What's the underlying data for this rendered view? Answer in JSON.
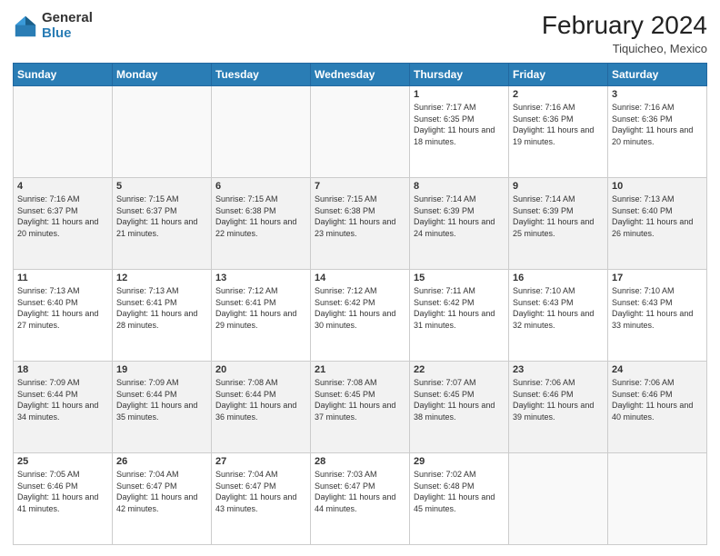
{
  "header": {
    "logo_line1": "General",
    "logo_line2": "Blue",
    "month_year": "February 2024",
    "location": "Tiquicheo, Mexico"
  },
  "days_of_week": [
    "Sunday",
    "Monday",
    "Tuesday",
    "Wednesday",
    "Thursday",
    "Friday",
    "Saturday"
  ],
  "weeks": [
    [
      {
        "day": "",
        "info": ""
      },
      {
        "day": "",
        "info": ""
      },
      {
        "day": "",
        "info": ""
      },
      {
        "day": "",
        "info": ""
      },
      {
        "day": "1",
        "info": "Sunrise: 7:17 AM\nSunset: 6:35 PM\nDaylight: 11 hours\nand 18 minutes."
      },
      {
        "day": "2",
        "info": "Sunrise: 7:16 AM\nSunset: 6:36 PM\nDaylight: 11 hours\nand 19 minutes."
      },
      {
        "day": "3",
        "info": "Sunrise: 7:16 AM\nSunset: 6:36 PM\nDaylight: 11 hours\nand 20 minutes."
      }
    ],
    [
      {
        "day": "4",
        "info": "Sunrise: 7:16 AM\nSunset: 6:37 PM\nDaylight: 11 hours\nand 20 minutes."
      },
      {
        "day": "5",
        "info": "Sunrise: 7:15 AM\nSunset: 6:37 PM\nDaylight: 11 hours\nand 21 minutes."
      },
      {
        "day": "6",
        "info": "Sunrise: 7:15 AM\nSunset: 6:38 PM\nDaylight: 11 hours\nand 22 minutes."
      },
      {
        "day": "7",
        "info": "Sunrise: 7:15 AM\nSunset: 6:38 PM\nDaylight: 11 hours\nand 23 minutes."
      },
      {
        "day": "8",
        "info": "Sunrise: 7:14 AM\nSunset: 6:39 PM\nDaylight: 11 hours\nand 24 minutes."
      },
      {
        "day": "9",
        "info": "Sunrise: 7:14 AM\nSunset: 6:39 PM\nDaylight: 11 hours\nand 25 minutes."
      },
      {
        "day": "10",
        "info": "Sunrise: 7:13 AM\nSunset: 6:40 PM\nDaylight: 11 hours\nand 26 minutes."
      }
    ],
    [
      {
        "day": "11",
        "info": "Sunrise: 7:13 AM\nSunset: 6:40 PM\nDaylight: 11 hours\nand 27 minutes."
      },
      {
        "day": "12",
        "info": "Sunrise: 7:13 AM\nSunset: 6:41 PM\nDaylight: 11 hours\nand 28 minutes."
      },
      {
        "day": "13",
        "info": "Sunrise: 7:12 AM\nSunset: 6:41 PM\nDaylight: 11 hours\nand 29 minutes."
      },
      {
        "day": "14",
        "info": "Sunrise: 7:12 AM\nSunset: 6:42 PM\nDaylight: 11 hours\nand 30 minutes."
      },
      {
        "day": "15",
        "info": "Sunrise: 7:11 AM\nSunset: 6:42 PM\nDaylight: 11 hours\nand 31 minutes."
      },
      {
        "day": "16",
        "info": "Sunrise: 7:10 AM\nSunset: 6:43 PM\nDaylight: 11 hours\nand 32 minutes."
      },
      {
        "day": "17",
        "info": "Sunrise: 7:10 AM\nSunset: 6:43 PM\nDaylight: 11 hours\nand 33 minutes."
      }
    ],
    [
      {
        "day": "18",
        "info": "Sunrise: 7:09 AM\nSunset: 6:44 PM\nDaylight: 11 hours\nand 34 minutes."
      },
      {
        "day": "19",
        "info": "Sunrise: 7:09 AM\nSunset: 6:44 PM\nDaylight: 11 hours\nand 35 minutes."
      },
      {
        "day": "20",
        "info": "Sunrise: 7:08 AM\nSunset: 6:44 PM\nDaylight: 11 hours\nand 36 minutes."
      },
      {
        "day": "21",
        "info": "Sunrise: 7:08 AM\nSunset: 6:45 PM\nDaylight: 11 hours\nand 37 minutes."
      },
      {
        "day": "22",
        "info": "Sunrise: 7:07 AM\nSunset: 6:45 PM\nDaylight: 11 hours\nand 38 minutes."
      },
      {
        "day": "23",
        "info": "Sunrise: 7:06 AM\nSunset: 6:46 PM\nDaylight: 11 hours\nand 39 minutes."
      },
      {
        "day": "24",
        "info": "Sunrise: 7:06 AM\nSunset: 6:46 PM\nDaylight: 11 hours\nand 40 minutes."
      }
    ],
    [
      {
        "day": "25",
        "info": "Sunrise: 7:05 AM\nSunset: 6:46 PM\nDaylight: 11 hours\nand 41 minutes."
      },
      {
        "day": "26",
        "info": "Sunrise: 7:04 AM\nSunset: 6:47 PM\nDaylight: 11 hours\nand 42 minutes."
      },
      {
        "day": "27",
        "info": "Sunrise: 7:04 AM\nSunset: 6:47 PM\nDaylight: 11 hours\nand 43 minutes."
      },
      {
        "day": "28",
        "info": "Sunrise: 7:03 AM\nSunset: 6:47 PM\nDaylight: 11 hours\nand 44 minutes."
      },
      {
        "day": "29",
        "info": "Sunrise: 7:02 AM\nSunset: 6:48 PM\nDaylight: 11 hours\nand 45 minutes."
      },
      {
        "day": "",
        "info": ""
      },
      {
        "day": "",
        "info": ""
      }
    ]
  ]
}
